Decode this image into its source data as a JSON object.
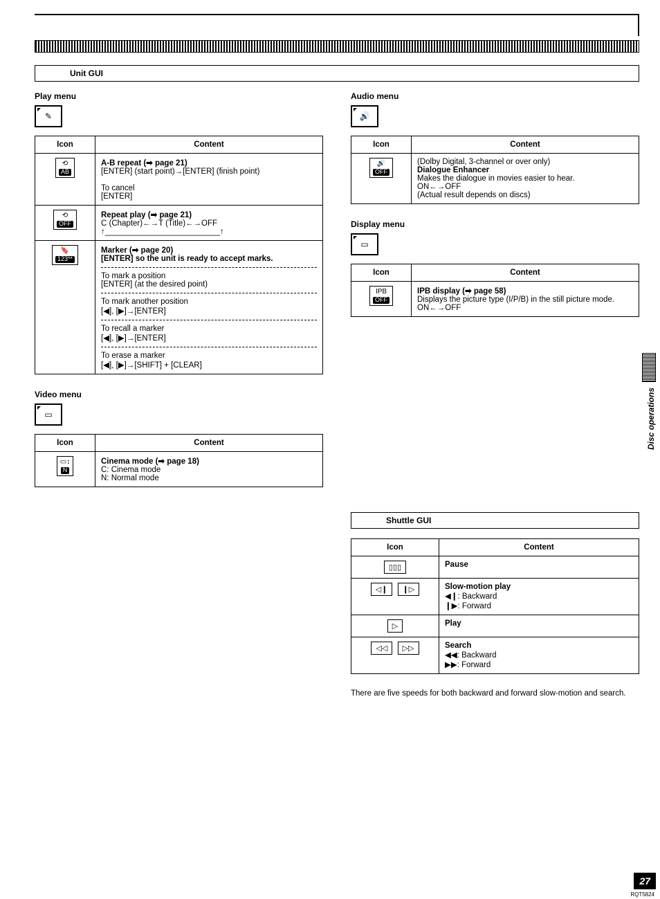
{
  "page": {
    "unit_gui_label": "Unit GUI",
    "shuttle_gui_label": "Shuttle GUI",
    "side_tab": "Disc operations",
    "page_number": "27",
    "doc_code": "RQT5824",
    "table_header_icon": "Icon",
    "table_header_content": "Content"
  },
  "play_menu": {
    "heading": "Play menu",
    "rows": [
      {
        "icon_top": "⟲",
        "icon_badge": "AB",
        "title": "A-B repeat (➡ page 21)",
        "line1": "[ENTER] (start point)→[ENTER] (finish point)",
        "line2": "To cancel",
        "line3": "[ENTER]"
      },
      {
        "icon_top": "⟲",
        "icon_badge": "OFF",
        "title": "Repeat play (➡ page 21)",
        "line1": "C (Chapter)←→T (Title)←→OFF",
        "line2": "↑__________________________↑"
      },
      {
        "icon_top": "🔖",
        "icon_badge": "123**",
        "title": "Marker (➡ page 20)",
        "bold_line": "[ENTER] so the unit is ready to accept marks.",
        "seg1a": "To mark a position",
        "seg1b": "[ENTER] (at the desired point)",
        "seg2a": "To mark another position",
        "seg2b": "[◀], [▶]→[ENTER]",
        "seg3a": "To recall a marker",
        "seg3b": "[◀], [▶]→[ENTER]",
        "seg4a": "To erase a marker",
        "seg4b": "[◀], [▶]→[SHIFT] + [CLEAR]"
      }
    ]
  },
  "video_menu": {
    "heading": "Video menu",
    "rows": [
      {
        "icon_top": "▭↕",
        "icon_badge": "N",
        "title": "Cinema mode (➡ page 18)",
        "line1": "C: Cinema mode",
        "line2": "N: Normal mode"
      }
    ]
  },
  "audio_menu": {
    "heading": "Audio menu",
    "rows": [
      {
        "icon_top": "🔊",
        "icon_badge": "OFF",
        "pre": "(Dolby Digital, 3-channel or over only)",
        "title": "Dialogue Enhancer",
        "line1": "Makes the dialogue in movies easier to hear.",
        "line2": "ON←→OFF",
        "line3": "(Actual result depends on discs)"
      }
    ]
  },
  "display_menu": {
    "heading": "Display menu",
    "rows": [
      {
        "icon_top": "IPB",
        "icon_badge": "OFF",
        "title": "IPB display (➡ page 58)",
        "line1": "Displays the picture type (I/P/B) in the still picture mode.",
        "line2": "ON←→OFF"
      }
    ]
  },
  "shuttle": {
    "rows": [
      {
        "icon": "▯▯▯",
        "title": "Pause"
      },
      {
        "icon": "◁❙  ❙▷",
        "title": "Slow-motion play",
        "line1": "◀❙: Backward",
        "line2": "❙▶: Forward"
      },
      {
        "icon": "▷",
        "title": "Play"
      },
      {
        "icon": "◁◁  ▷▷",
        "title": "Search",
        "line1": "◀◀: Backward",
        "line2": "▶▶: Forward"
      }
    ],
    "note": "There are five speeds for both backward and forward slow-motion and search."
  }
}
